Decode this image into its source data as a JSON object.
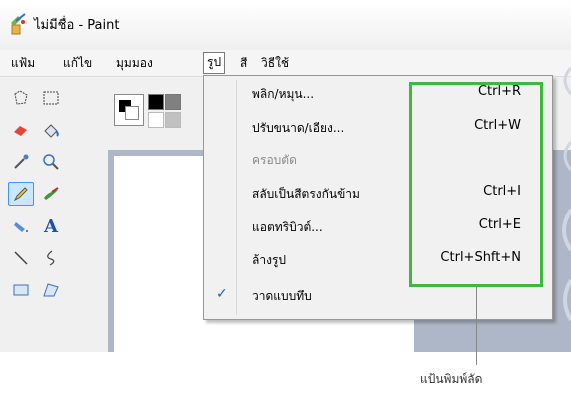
{
  "window": {
    "title": "ไม่มีชื่อ - Paint"
  },
  "menubar": {
    "items": [
      {
        "label": "แฟ้ม"
      },
      {
        "label": "แก้ไข"
      },
      {
        "label": "มุมมอง"
      },
      {
        "label": "รูป"
      },
      {
        "label": "สี"
      },
      {
        "label": "วิธีใช้"
      }
    ]
  },
  "image_menu": {
    "items": [
      {
        "label": "พลิก/หมุน...",
        "shortcut": "Ctrl+R"
      },
      {
        "label": "ปรับขนาด/เอียง...",
        "shortcut": "Ctrl+W"
      },
      {
        "label": "ครอบตัด",
        "shortcut": ""
      },
      {
        "label": "สลับเป็นสีตรงกันข้าม",
        "shortcut": "Ctrl+I"
      },
      {
        "label": "แอตทริบิวต์...",
        "shortcut": "Ctrl+E"
      },
      {
        "label": "ล้างรูป",
        "shortcut": "Ctrl+Shft+N"
      },
      {
        "label": "วาดแบบทึบ",
        "shortcut": ""
      }
    ]
  },
  "annotation": {
    "label": "แป้นพิมพ์ลัด"
  },
  "colors": {
    "highlight": "#3dba3d",
    "canvas_bg": "#aeb7c8"
  }
}
